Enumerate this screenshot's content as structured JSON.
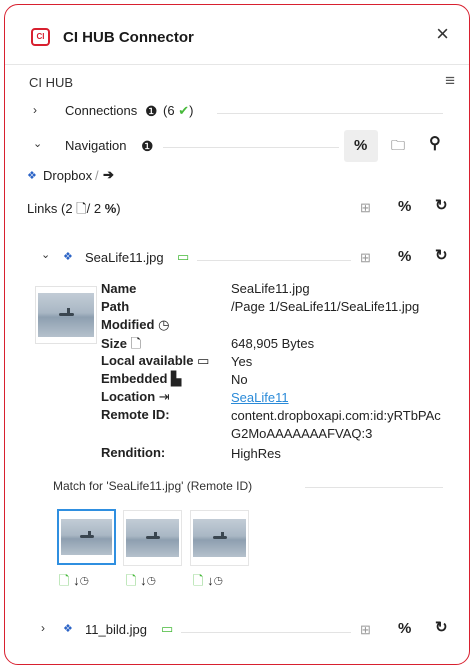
{
  "window": {
    "title": "CI HUB Connector",
    "logo_text": "CI",
    "close_glyph": "×"
  },
  "section": {
    "title": "CI HUB",
    "menu_glyph": "≡"
  },
  "connections": {
    "label": "Connections",
    "count": "(6",
    "check": "✔",
    "close_paren": ")"
  },
  "navigation": {
    "label": "Navigation",
    "info_glyph": "❶"
  },
  "breadcrumb": {
    "item": "Dropbox",
    "separator": "/",
    "arrow": "➔"
  },
  "links": {
    "label": "Links",
    "open": "(2",
    "mid": "/ 2",
    "close": ")"
  },
  "file": {
    "name": "SeaLife11.jpg",
    "details": [
      {
        "label": "Name",
        "value": "SeaLife11.jpg"
      },
      {
        "label": "Path",
        "value": "/Page 1/SeaLife11/SeaLife11.jpg"
      },
      {
        "label": "Modified",
        "value": ""
      },
      {
        "label": "Size",
        "value": "648,905 Bytes"
      },
      {
        "label": "Local available",
        "value": "Yes"
      },
      {
        "label": "Embedded",
        "value": "No"
      },
      {
        "label": "Location",
        "value": "SeaLife11"
      },
      {
        "label": "Remote ID:",
        "value": "content.dropboxapi.com:id:yRTbPAc"
      },
      {
        "label": "",
        "value": "G2MoAAAAAAAFVAQ:3"
      },
      {
        "label": "Rendition:",
        "value": "HighRes"
      }
    ],
    "match_label": "Match for 'SeaLife11.jpg' (Remote ID)"
  },
  "second_file": {
    "name": "11_bild.jpg"
  },
  "colors": {
    "accent": "#d8202f",
    "dropbox": "#2b63c6",
    "green": "#46b93a",
    "selected": "#2f8fe0",
    "link": "#2a8ad8"
  },
  "icons": [
    "ci-hub-logo",
    "close",
    "menu",
    "chevron",
    "info",
    "check",
    "link",
    "folder",
    "search",
    "dropbox",
    "arrow",
    "document",
    "add-box",
    "refresh",
    "laptop",
    "embedded",
    "location",
    "clock"
  ]
}
